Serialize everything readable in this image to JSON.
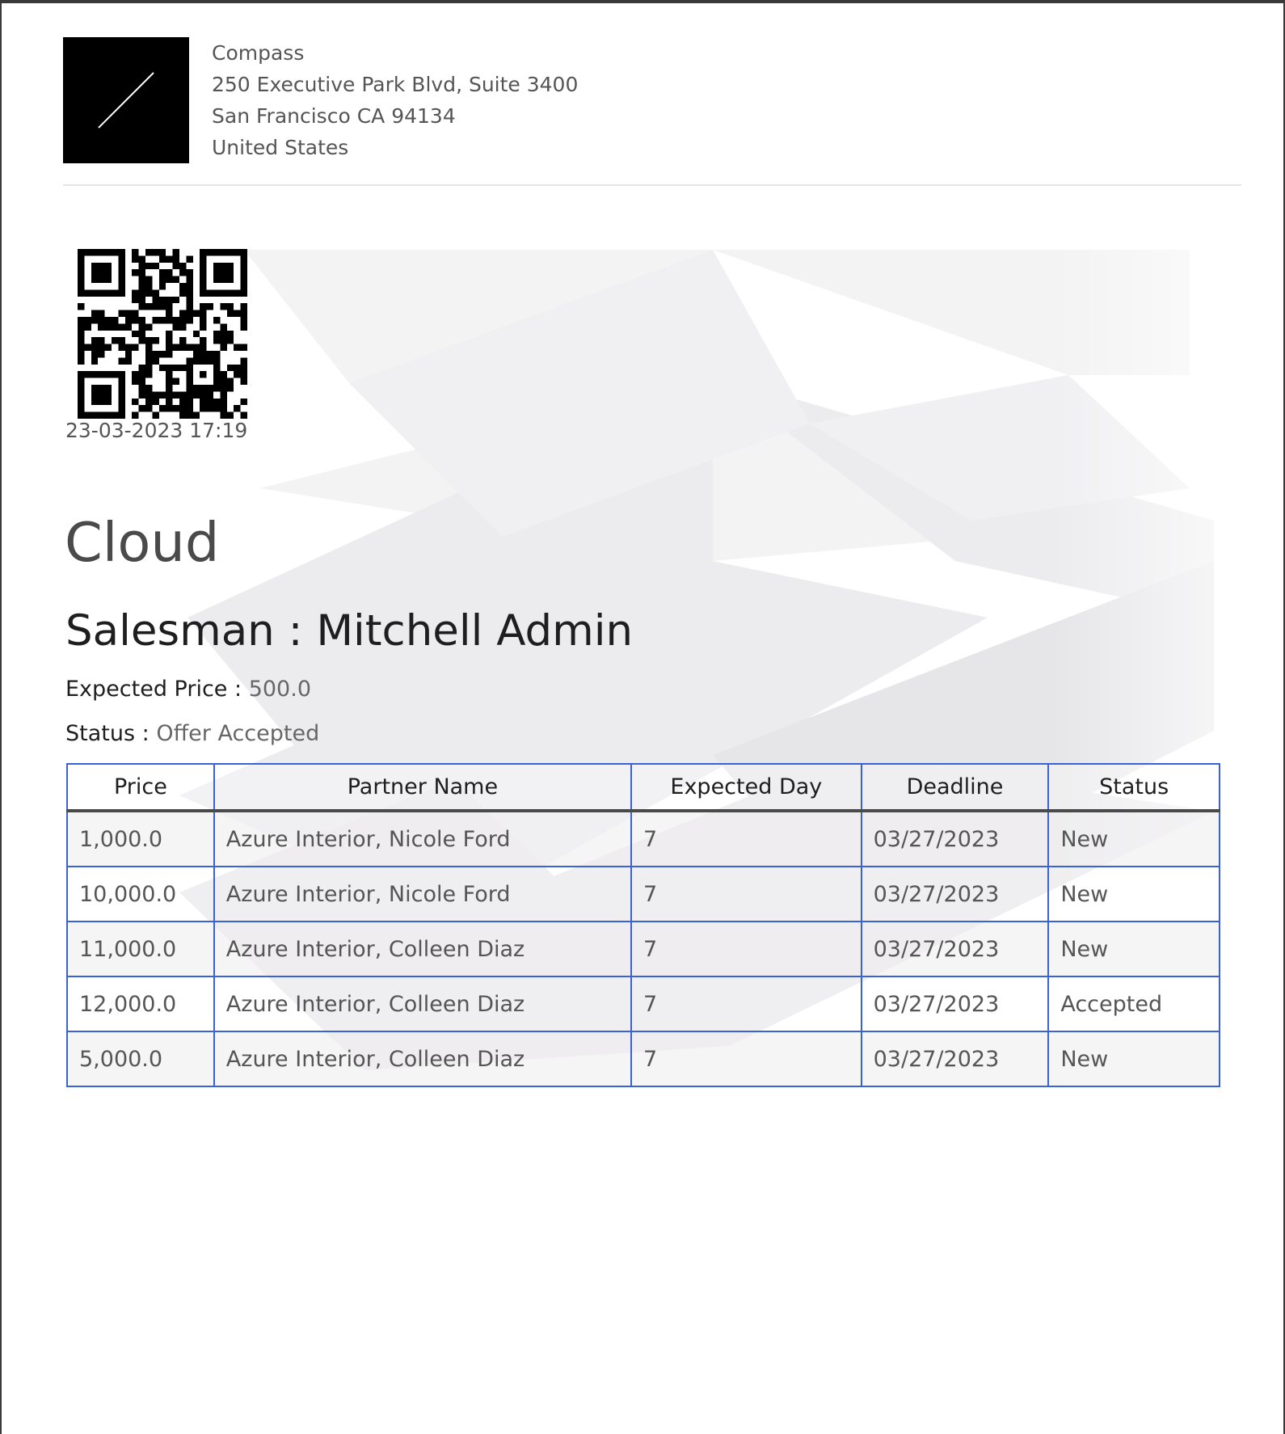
{
  "company": {
    "name": "Compass",
    "address_line1": "250 Executive Park Blvd, Suite 3400",
    "address_line2": "San Francisco CA 94134",
    "country": "United States"
  },
  "timestamp": "23-03-2023 17:19",
  "title": "Cloud",
  "salesman": {
    "label": "Salesman :",
    "value": "Mitchell Admin"
  },
  "expected_price": {
    "label": "Expected Price :",
    "value": "500.0"
  },
  "status": {
    "label": "Status :",
    "value": "Offer Accepted"
  },
  "offers_table": {
    "columns": [
      "Price",
      "Partner Name",
      "Expected Day",
      "Deadline",
      "Status"
    ],
    "rows": [
      [
        "1,000.0",
        "Azure Interior, Nicole Ford",
        "7",
        "03/27/2023",
        "New"
      ],
      [
        "10,000.0",
        "Azure Interior, Nicole Ford",
        "7",
        "03/27/2023",
        "New"
      ],
      [
        "11,000.0",
        "Azure Interior, Colleen Diaz",
        "7",
        "03/27/2023",
        "New"
      ],
      [
        "12,000.0",
        "Azure Interior, Colleen Diaz",
        "7",
        "03/27/2023",
        "Accepted"
      ],
      [
        "5,000.0",
        "Azure Interior, Colleen Diaz",
        "7",
        "03/27/2023",
        "New"
      ]
    ]
  },
  "colors": {
    "table_border": "#3a62d6",
    "logo_background": "#000000"
  },
  "icons": {
    "logo": "company-logo-slash",
    "qr": "qr-code"
  }
}
